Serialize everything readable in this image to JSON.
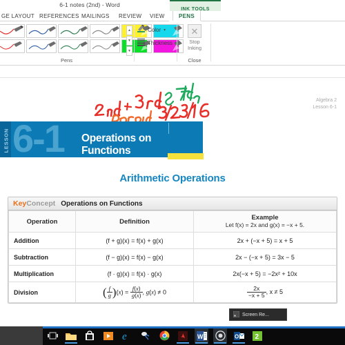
{
  "window": {
    "title": "6-1 notes (2nd) - Word",
    "contextual_tab_group": "INK TOOLS"
  },
  "ribbon": {
    "tabs": [
      {
        "label": "GE LAYOUT",
        "active": false
      },
      {
        "label": "REFERENCES",
        "active": false
      },
      {
        "label": "MAILINGS",
        "active": false
      },
      {
        "label": "REVIEW",
        "active": false
      },
      {
        "label": "VIEW",
        "active": false
      },
      {
        "label": "PENS",
        "active": true
      }
    ],
    "groups": {
      "pens": {
        "label": "Pens",
        "scroll_up": "▲",
        "scroll_down": "▼",
        "more": "▼",
        "row1": [
          "red-pen",
          "blue-pen",
          "green-pen",
          "black-pen",
          "yellow-highlighter",
          "cyan-highlighter"
        ],
        "row2": [
          "red-pen-thin",
          "blue-pen-thin",
          "green-pen-thin",
          "black-pen-thin",
          "green-highlighter",
          "magenta-highlighter"
        ]
      },
      "tools": {
        "color_label": "Color",
        "thickness_label": "Thickness",
        "caret": "▾"
      },
      "close": {
        "label": "Close",
        "stop_line1": "Stop",
        "stop_line2": "Inking",
        "icon_glyph": "✕"
      }
    }
  },
  "document": {
    "ink_annotations": [
      {
        "text": "2nd +",
        "color": "#e8302a"
      },
      {
        "text": "3rd",
        "color": "#e8302a"
      },
      {
        "text": "& 7th",
        "color": "#1faa5e"
      },
      {
        "text": "period",
        "color": "#f0682a"
      },
      {
        "text": "3/28/16",
        "color": "#e8302a"
      }
    ],
    "corner_label": {
      "line1": "Algebra 2",
      "line2": "Lesson 6-1"
    },
    "banner": {
      "lesson_word": "LESSON",
      "number": "6-1",
      "title": "Operations on Functions",
      "bg_color": "#0c7ab5",
      "accent_color": "#f5e03c"
    },
    "section_heading": "Arithmetic Operations",
    "key_concept": {
      "key_word": "Key",
      "concept_word": "Concept",
      "title": "Operations on Functions",
      "columns": [
        "Operation",
        "Definition",
        "Example"
      ],
      "example_subtitle": "Let f(x) = 2x and g(x) = −x + 5.",
      "rows": [
        {
          "operation": "Addition",
          "definition": "(f + g)(x) = f(x) + g(x)",
          "example": "2x + (−x + 5) = x + 5"
        },
        {
          "operation": "Subtraction",
          "definition": "(f − g)(x) = f(x) − g(x)",
          "example": "2x − (−x + 5) = 3x − 5"
        },
        {
          "operation": "Multiplication",
          "definition": "(f · g)(x) = f(x) · g(x)",
          "example": "2x(−x + 5) = −2x² + 10x"
        },
        {
          "operation": "Division",
          "definition": "(f/g)(x) = f(x)/g(x), g(x) ≠ 0",
          "example": "2x / (−x + 5), x ≠ 5",
          "example_numerator": "2x",
          "example_denominator": "−x + 5",
          "example_condition": ", x ≠ 5"
        }
      ]
    }
  },
  "taskbar": {
    "preview_label": "Screen Re...",
    "items": [
      {
        "name": "task-view",
        "glyph": "❐"
      },
      {
        "name": "file-explorer",
        "glyph": ""
      },
      {
        "name": "store",
        "glyph": ""
      },
      {
        "name": "movies-tv",
        "glyph": ""
      },
      {
        "name": "internet-explorer",
        "glyph": "e"
      },
      {
        "name": "paint-3d",
        "glyph": ""
      },
      {
        "name": "chrome",
        "glyph": ""
      },
      {
        "name": "adobe-reader",
        "glyph": "A"
      },
      {
        "name": "word",
        "glyph": "W"
      },
      {
        "name": "screen-recorder",
        "glyph": "◉"
      },
      {
        "name": "outlook",
        "glyph": "O"
      },
      {
        "name": "app-two",
        "glyph": "2"
      }
    ]
  }
}
